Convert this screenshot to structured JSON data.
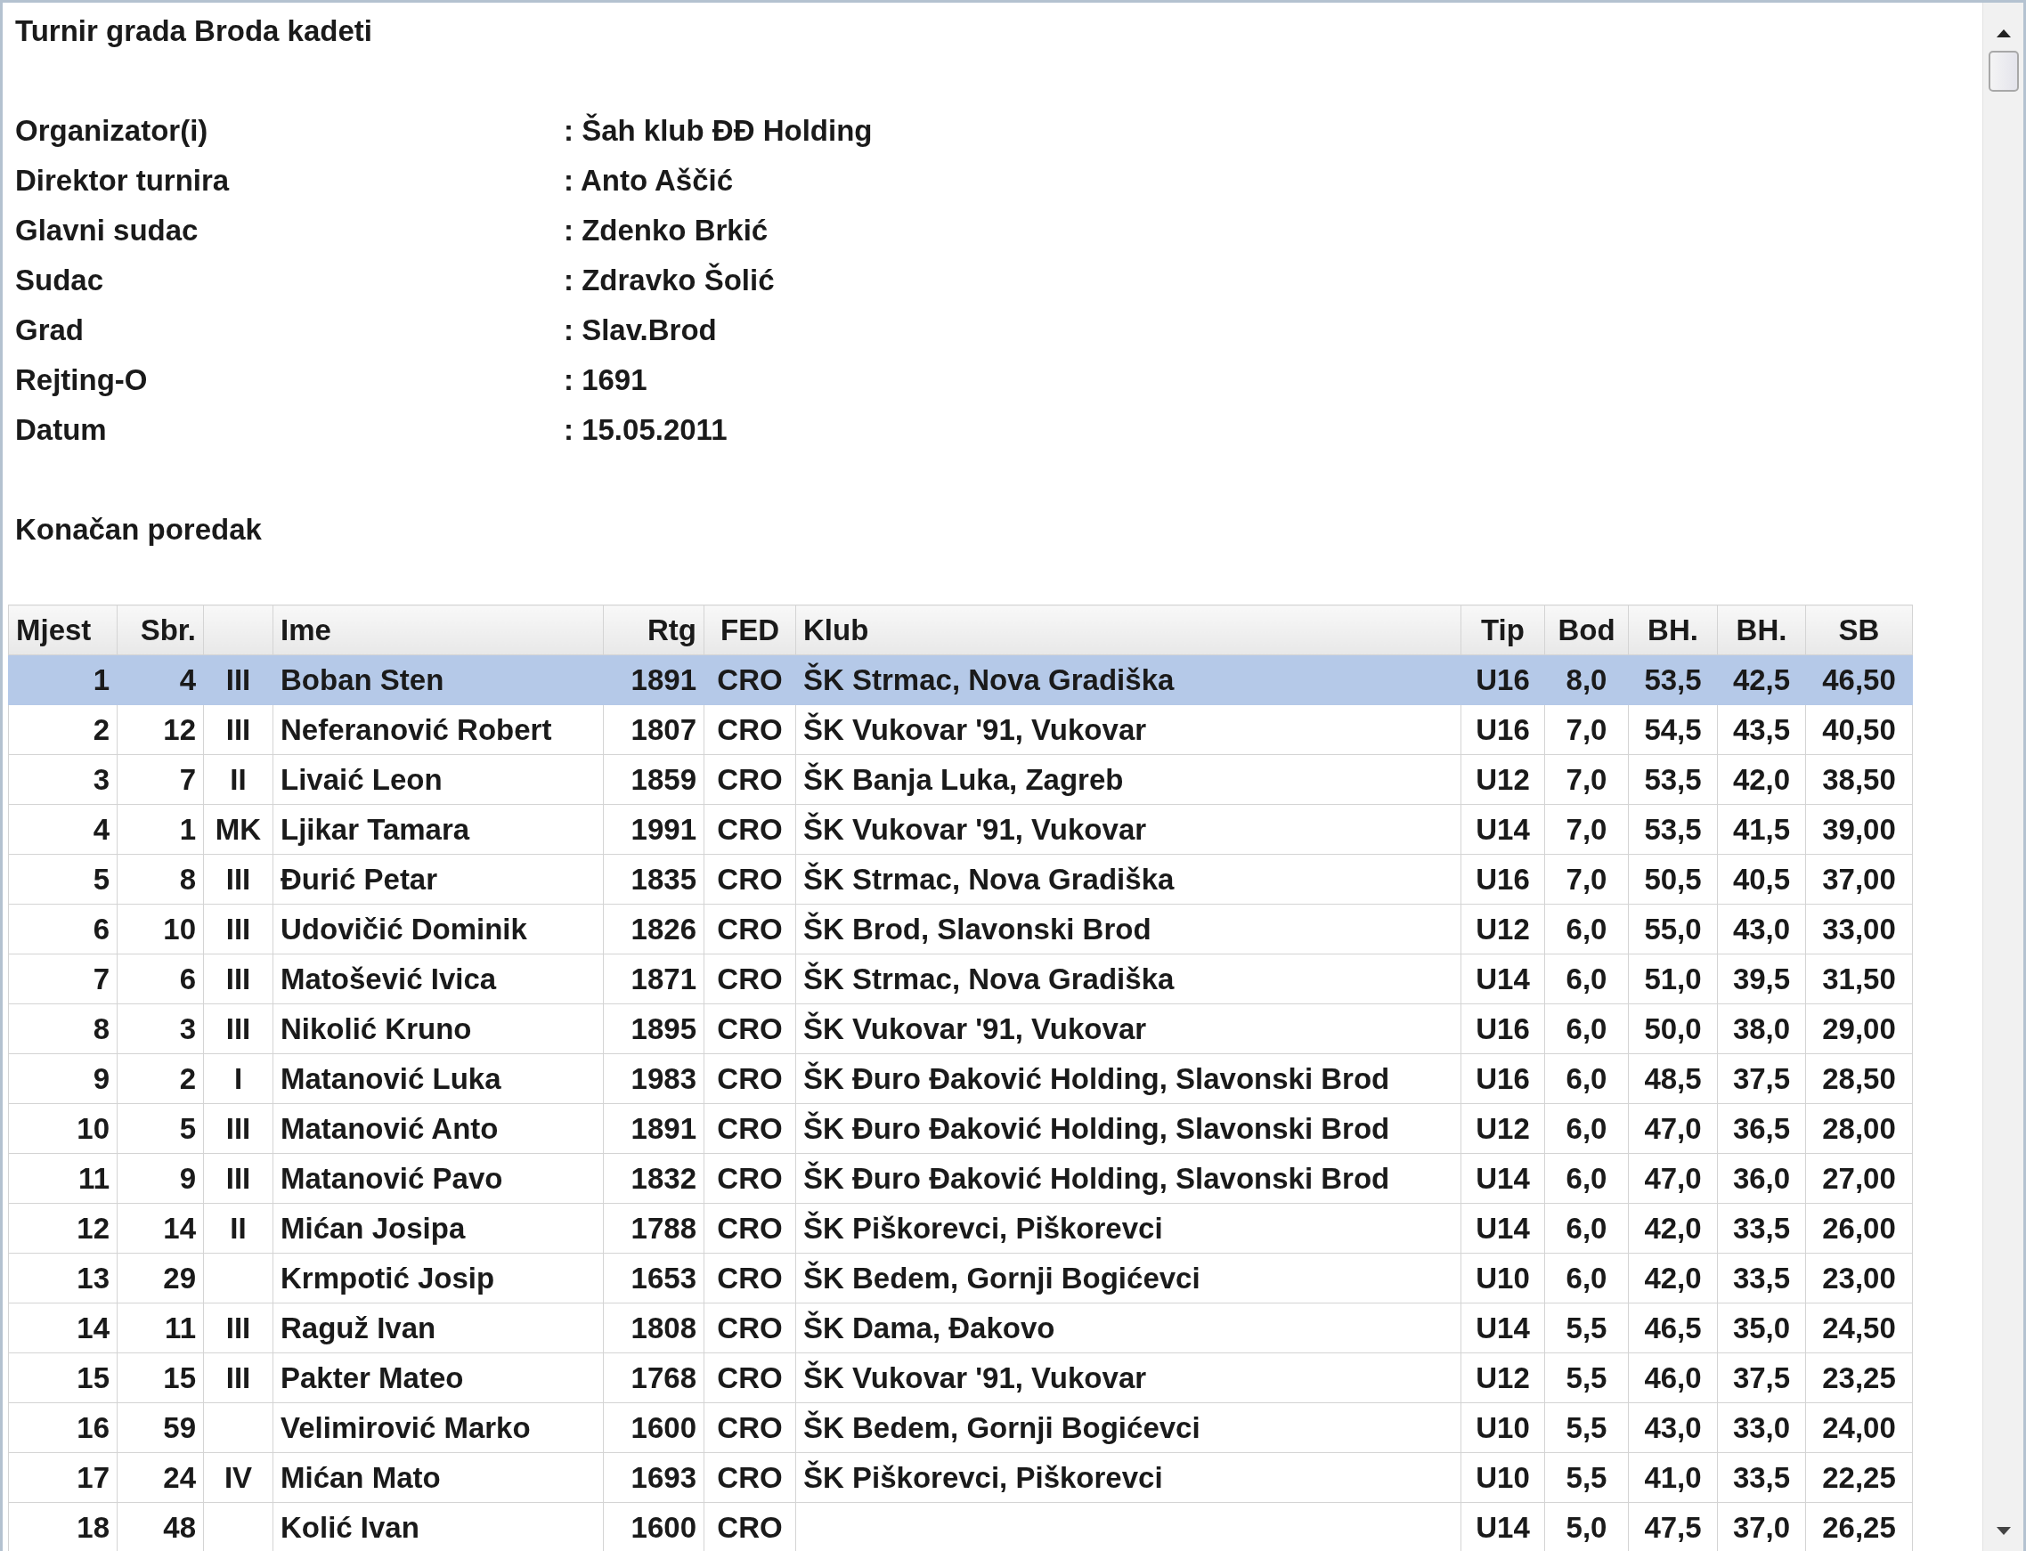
{
  "title": "Turnir grada Broda kadeti",
  "info": [
    {
      "label": "Organizator(i)",
      "value": ": Šah klub ĐĐ Holding"
    },
    {
      "label": "Direktor turnira",
      "value": ": Anto Aščić"
    },
    {
      "label": "Glavni sudac",
      "value": ": Zdenko Brkić"
    },
    {
      "label": "Sudac",
      "value": ": Zdravko Šolić"
    },
    {
      "label": "Grad",
      "value": ": Slav.Brod"
    },
    {
      "label": "Rejting-O",
      "value": ": 1691"
    },
    {
      "label": "Datum",
      "value": ": 15.05.2011"
    }
  ],
  "section_title": "Konačan poredak",
  "table": {
    "columns": [
      {
        "label": "Mjest"
      },
      {
        "label": "Sbr."
      },
      {},
      {
        "label": "Ime"
      },
      {
        "label": "Rtg"
      },
      {
        "label": "FED"
      },
      {
        "label": "Klub"
      },
      {
        "label": "Tip"
      },
      {
        "label": "Bod"
      },
      {
        "label": "BH."
      },
      {
        "label": "BH."
      },
      {
        "label": "SB"
      }
    ],
    "rows": [
      {
        "selected": true,
        "place": "1",
        "no": "4",
        "title": "III",
        "name": "Boban Sten",
        "rtg": "1891",
        "fed": "CRO",
        "club": "ŠK Strmac, Nova Gradiška",
        "tip": "U16",
        "bod": "8,0",
        "bh1": "53,5",
        "bh2": "42,5",
        "sb": "46,50"
      },
      {
        "selected": false,
        "place": "2",
        "no": "12",
        "title": "III",
        "name": "Neferanović Robert",
        "rtg": "1807",
        "fed": "CRO",
        "club": "ŠK Vukovar '91, Vukovar",
        "tip": "U16",
        "bod": "7,0",
        "bh1": "54,5",
        "bh2": "43,5",
        "sb": "40,50"
      },
      {
        "selected": false,
        "place": "3",
        "no": "7",
        "title": "II",
        "name": "Livaić Leon",
        "rtg": "1859",
        "fed": "CRO",
        "club": "ŠK Banja Luka, Zagreb",
        "tip": "U12",
        "bod": "7,0",
        "bh1": "53,5",
        "bh2": "42,0",
        "sb": "38,50"
      },
      {
        "selected": false,
        "place": "4",
        "no": "1",
        "title": "MK",
        "name": "Ljikar Tamara",
        "rtg": "1991",
        "fed": "CRO",
        "club": "ŠK Vukovar '91, Vukovar",
        "tip": "U14",
        "bod": "7,0",
        "bh1": "53,5",
        "bh2": "41,5",
        "sb": "39,00"
      },
      {
        "selected": false,
        "place": "5",
        "no": "8",
        "title": "III",
        "name": "Đurić Petar",
        "rtg": "1835",
        "fed": "CRO",
        "club": "ŠK Strmac, Nova Gradiška",
        "tip": "U16",
        "bod": "7,0",
        "bh1": "50,5",
        "bh2": "40,5",
        "sb": "37,00"
      },
      {
        "selected": false,
        "place": "6",
        "no": "10",
        "title": "III",
        "name": "Udovičić Dominik",
        "rtg": "1826",
        "fed": "CRO",
        "club": "ŠK Brod, Slavonski Brod",
        "tip": "U12",
        "bod": "6,0",
        "bh1": "55,0",
        "bh2": "43,0",
        "sb": "33,00"
      },
      {
        "selected": false,
        "place": "7",
        "no": "6",
        "title": "III",
        "name": "Matošević Ivica",
        "rtg": "1871",
        "fed": "CRO",
        "club": "ŠK Strmac, Nova Gradiška",
        "tip": "U14",
        "bod": "6,0",
        "bh1": "51,0",
        "bh2": "39,5",
        "sb": "31,50"
      },
      {
        "selected": false,
        "place": "8",
        "no": "3",
        "title": "III",
        "name": "Nikolić Kruno",
        "rtg": "1895",
        "fed": "CRO",
        "club": "ŠK Vukovar '91, Vukovar",
        "tip": "U16",
        "bod": "6,0",
        "bh1": "50,0",
        "bh2": "38,0",
        "sb": "29,00"
      },
      {
        "selected": false,
        "place": "9",
        "no": "2",
        "title": "I",
        "name": "Matanović Luka",
        "rtg": "1983",
        "fed": "CRO",
        "club": "ŠK Đuro Đaković Holding, Slavonski Brod",
        "tip": "U16",
        "bod": "6,0",
        "bh1": "48,5",
        "bh2": "37,5",
        "sb": "28,50"
      },
      {
        "selected": false,
        "place": "10",
        "no": "5",
        "title": "III",
        "name": "Matanović Anto",
        "rtg": "1891",
        "fed": "CRO",
        "club": "ŠK Đuro Đaković Holding, Slavonski Brod",
        "tip": "U12",
        "bod": "6,0",
        "bh1": "47,0",
        "bh2": "36,5",
        "sb": "28,00"
      },
      {
        "selected": false,
        "place": "11",
        "no": "9",
        "title": "III",
        "name": "Matanović Pavo",
        "rtg": "1832",
        "fed": "CRO",
        "club": "ŠK Đuro Đaković Holding, Slavonski Brod",
        "tip": "U14",
        "bod": "6,0",
        "bh1": "47,0",
        "bh2": "36,0",
        "sb": "27,00"
      },
      {
        "selected": false,
        "place": "12",
        "no": "14",
        "title": "II",
        "name": "Mićan Josipa",
        "rtg": "1788",
        "fed": "CRO",
        "club": "ŠK Piškorevci, Piškorevci",
        "tip": "U14",
        "bod": "6,0",
        "bh1": "42,0",
        "bh2": "33,5",
        "sb": "26,00"
      },
      {
        "selected": false,
        "place": "13",
        "no": "29",
        "name": "Krmpotić Josip",
        "rtg": "1653",
        "fed": "CRO",
        "club": "ŠK Bedem, Gornji Bogićevci",
        "tip": "U10",
        "bod": "6,0",
        "bh1": "42,0",
        "bh2": "33,5",
        "sb": "23,00"
      },
      {
        "selected": false,
        "place": "14",
        "no": "11",
        "title": "III",
        "name": "Raguž Ivan",
        "rtg": "1808",
        "fed": "CRO",
        "club": "ŠK Dama, Đakovo",
        "tip": "U14",
        "bod": "5,5",
        "bh1": "46,5",
        "bh2": "35,0",
        "sb": "24,50"
      },
      {
        "selected": false,
        "place": "15",
        "no": "15",
        "title": "III",
        "name": "Pakter Mateo",
        "rtg": "1768",
        "fed": "CRO",
        "club": "ŠK Vukovar '91, Vukovar",
        "tip": "U12",
        "bod": "5,5",
        "bh1": "46,0",
        "bh2": "37,5",
        "sb": "23,25"
      },
      {
        "selected": false,
        "place": "16",
        "no": "59",
        "name": "Velimirović Marko",
        "rtg": "1600",
        "fed": "CRO",
        "club": "ŠK Bedem, Gornji Bogićevci",
        "tip": "U10",
        "bod": "5,5",
        "bh1": "43,0",
        "bh2": "33,0",
        "sb": "24,00"
      },
      {
        "selected": false,
        "place": "17",
        "no": "24",
        "title": "IV",
        "name": "Mićan Mato",
        "rtg": "1693",
        "fed": "CRO",
        "club": "ŠK Piškorevci, Piškorevci",
        "tip": "U10",
        "bod": "5,5",
        "bh1": "41,0",
        "bh2": "33,5",
        "sb": "22,25"
      },
      {
        "selected": false,
        "place": "18",
        "no": "48",
        "name": "Kolić Ivan",
        "rtg": "1600",
        "fed": "CRO",
        "tip": "U14",
        "bod": "5,0",
        "bh1": "47,5",
        "bh2": "37,0",
        "sb": "26,25"
      }
    ]
  }
}
